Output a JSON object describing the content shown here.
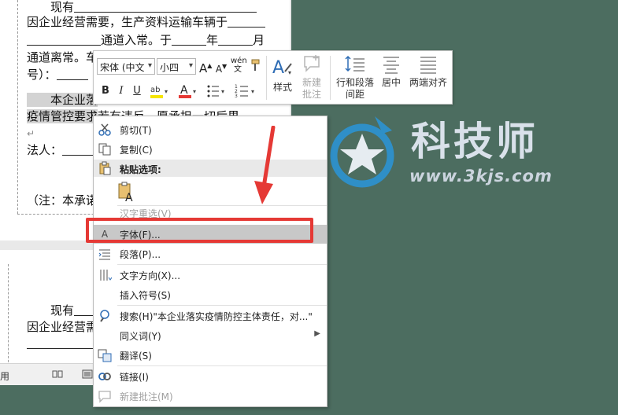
{
  "document": {
    "page1": {
      "line1": "现有",
      "line2": "因企业经营需要，生产资料运输车辆于",
      "line3_a": "通道入常。于",
      "line3_b": "年",
      "line3_c": "月",
      "line4": "通道离常。车",
      "line5": "号）：",
      "line6_sel": "本企业落",
      "line7_a": "疫情管控要求",
      "line7_b": "若有违反，愿承担一切后果",
      "line8": "法人：",
      "line9": "（注：本承诺"
    },
    "page2": {
      "line1": "现有",
      "line2": "因企业经营需"
    }
  },
  "statusbar": {
    "mode_text": "用"
  },
  "watermark": {
    "title": "科技师",
    "url": "www.3kjs.com"
  },
  "mini_toolbar": {
    "font_name": "宋体 (中文",
    "font_size": "小四",
    "grow_font": "A",
    "shrink_font": "A",
    "phonetic": "wén",
    "bold": "B",
    "italic": "I",
    "underline": "U",
    "font_color": "A",
    "styles_label": "样式",
    "new_comment_label": [
      "新建",
      "批注"
    ],
    "line_spacing_label": [
      "行和段落",
      "间距"
    ],
    "center_label": "居中",
    "justify_label": "两端对齐"
  },
  "context_menu": {
    "cut": "剪切(T)",
    "copy": "复制(C)",
    "paste_options": "粘贴选项:",
    "reconvert": "汉字重选(V)",
    "font": "字体(F)...",
    "paragraph": "段落(P)...",
    "text_direction": "文字方向(X)...",
    "insert_symbol": "插入符号(S)",
    "search": "搜索(H)\"本企业落实疫情防控主体责任，对...\"",
    "synonyms": "同义词(Y)",
    "translate": "翻译(S)",
    "link": "链接(I)",
    "new_comment": "新建批注(M)"
  },
  "colors": {
    "background": "#4c6d60",
    "highlight_box": "#e53935",
    "menu_highlight": "#c8c8c8",
    "font_color_bar": "#e53935",
    "highlight_color_bar": "#f5e400"
  }
}
